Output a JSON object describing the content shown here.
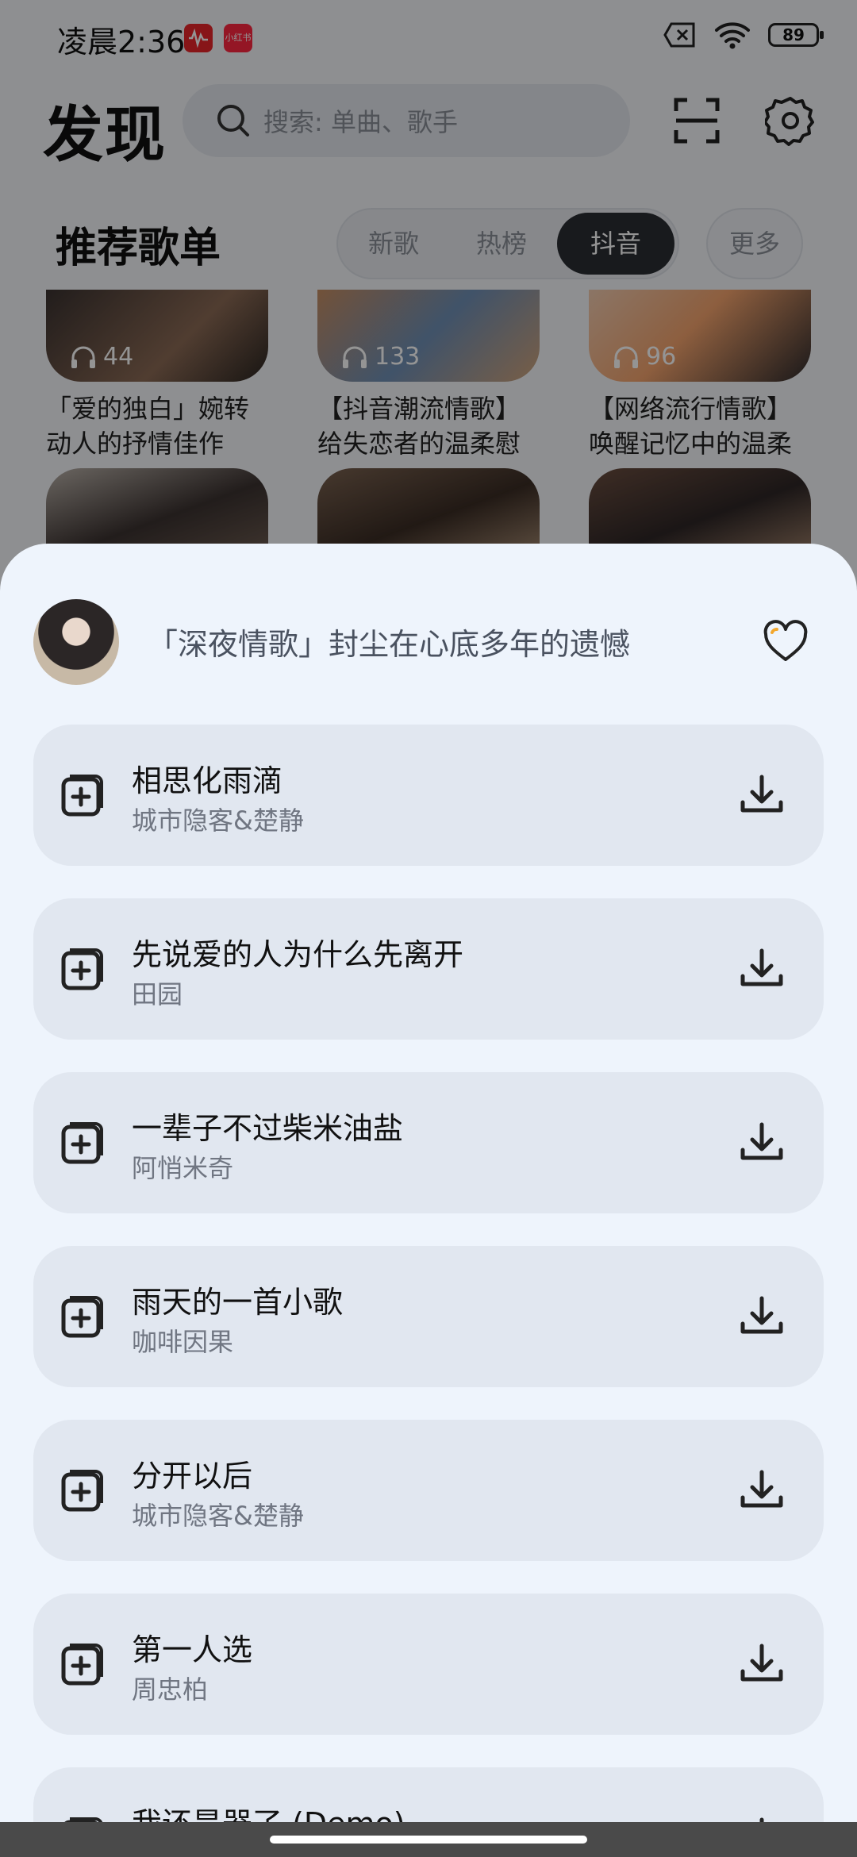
{
  "status_bar": {
    "time": "凌晨2:36",
    "badge_2": "小红书",
    "battery": "89"
  },
  "header": {
    "title": "发现",
    "search_placeholder": "搜索: 单曲、歌手"
  },
  "section": {
    "title": "推荐歌单",
    "tabs": [
      "新歌",
      "热榜",
      "抖音"
    ],
    "active_tab": "抖音",
    "more": "更多"
  },
  "cards": [
    {
      "plays": "44",
      "desc_line1": "「爱的独白」婉转",
      "desc_line2": "动人的抒情佳作"
    },
    {
      "plays": "133",
      "desc_line1": "【抖音潮流情歌】",
      "desc_line2": "给失恋者的温柔慰"
    },
    {
      "plays": "96",
      "desc_line1": "【网络流行情歌】",
      "desc_line2": "唤醒记忆中的温柔"
    }
  ],
  "sheet": {
    "playlist_title": "「深夜情歌」封尘在心底多年的遗憾",
    "songs": [
      {
        "title": "相思化雨滴",
        "artist": "城市隐客&楚静"
      },
      {
        "title": "先说爱的人为什么先离开",
        "artist": "田园"
      },
      {
        "title": "一辈子不过柴米油盐",
        "artist": "阿悄米奇"
      },
      {
        "title": "雨天的一首小歌",
        "artist": "咖啡因果"
      },
      {
        "title": "分开以后",
        "artist": "城市隐客&楚静"
      },
      {
        "title": "第一人选",
        "artist": "周忠柏"
      },
      {
        "title": "我还是器了 (Demo)",
        "artist": ""
      }
    ]
  },
  "colors": {
    "sheet_bg": "#eef4fc",
    "row_bg": "#e1e7f0",
    "active_tab_bg": "#2a2d33"
  }
}
